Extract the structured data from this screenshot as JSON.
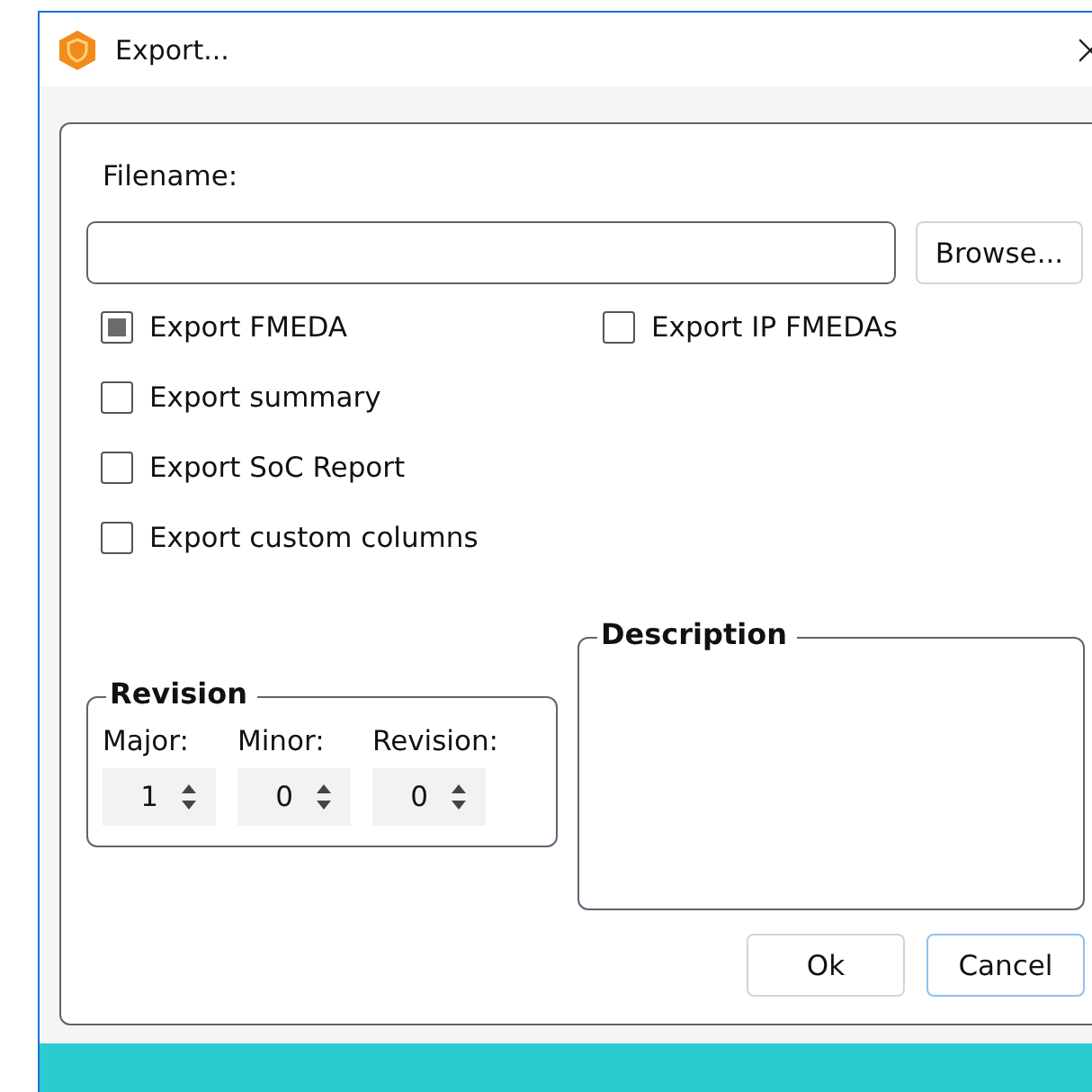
{
  "window": {
    "title": "Export..."
  },
  "filename": {
    "label": "Filename:"
  },
  "browse_button": {
    "label": "Browse..."
  },
  "options_left": [
    {
      "label": "Export FMEDA",
      "checked": true
    },
    {
      "label": "Export summary",
      "checked": false
    },
    {
      "label": "Export SoC Report",
      "checked": false
    },
    {
      "label": "Export custom columns",
      "checked": false
    }
  ],
  "options_right": [
    {
      "label": "Export IP FMEDAs",
      "checked": false
    }
  ],
  "revision": {
    "title": "Revision",
    "fields": [
      {
        "label": "Major:",
        "value": "1"
      },
      {
        "label": "Minor:",
        "value": "0"
      },
      {
        "label": "Revision:",
        "value": "0"
      }
    ]
  },
  "description": {
    "title": "Description"
  },
  "buttons": [
    {
      "label": "Ok",
      "focused": false
    },
    {
      "label": "Cancel",
      "focused": true
    }
  ]
}
